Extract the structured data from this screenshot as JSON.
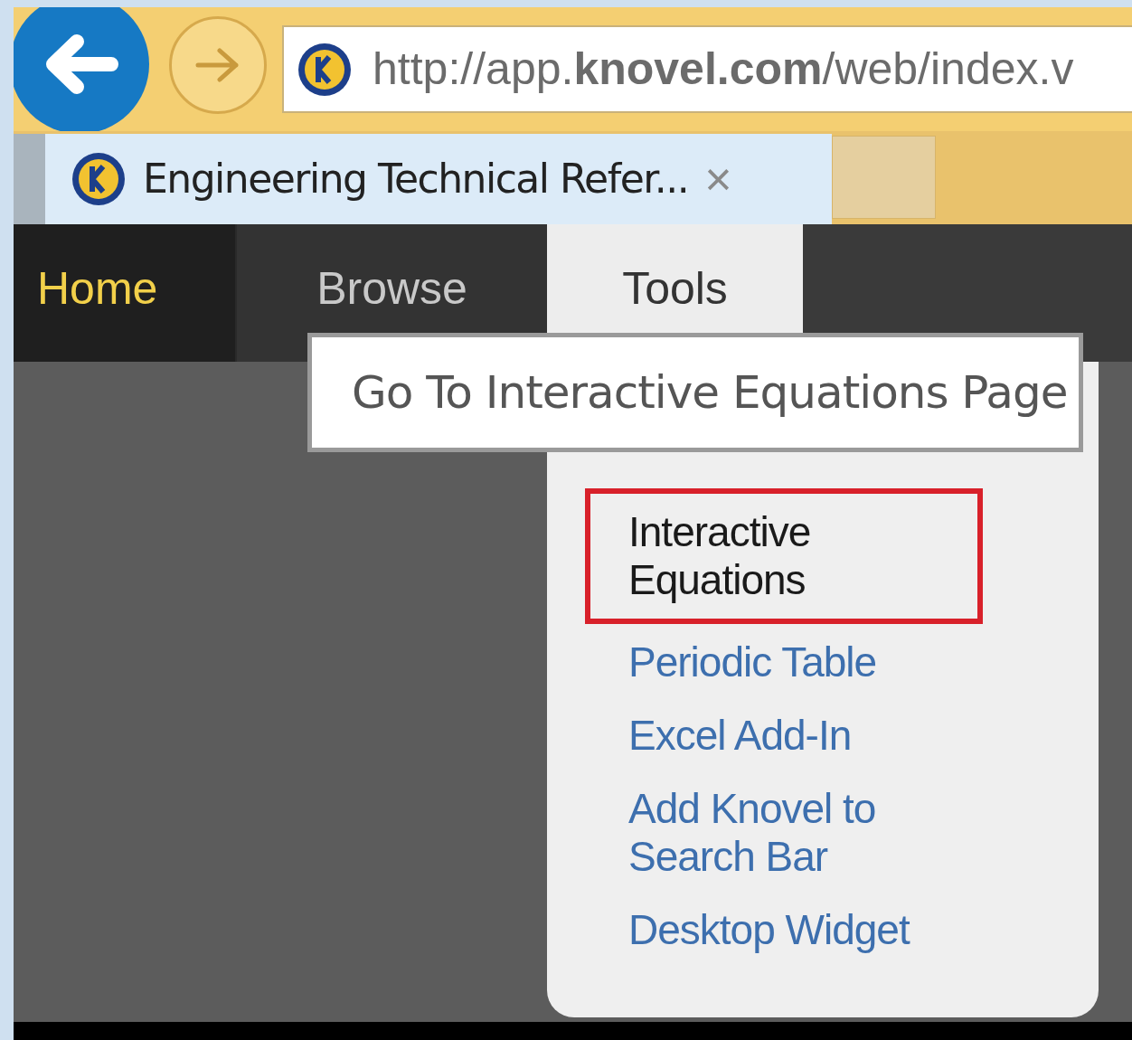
{
  "browser": {
    "address": {
      "url": "http://app.**knovel.com**/web/index.v"
    },
    "tabs": [
      {
        "title": "Engineering Technical Refer...",
        "close": "×",
        "selected": true
      }
    ]
  },
  "nav": [
    {
      "label": "Home",
      "active": true,
      "open": false
    },
    {
      "label": "Browse",
      "active": false,
      "open": false
    },
    {
      "label": "Tools",
      "active": false,
      "open": true
    }
  ],
  "tooltip": "Go To Interactive Equations Page",
  "menu": [
    {
      "label": "Interactive Equations",
      "highlighted": true
    },
    {
      "label": "Periodic Table",
      "highlighted": false
    },
    {
      "label": "Excel Add-In",
      "highlighted": false
    },
    {
      "label": "Add Knovel to Search Bar",
      "highlighted": false
    },
    {
      "label": "Desktop Widget",
      "highlighted": false
    }
  ]
}
